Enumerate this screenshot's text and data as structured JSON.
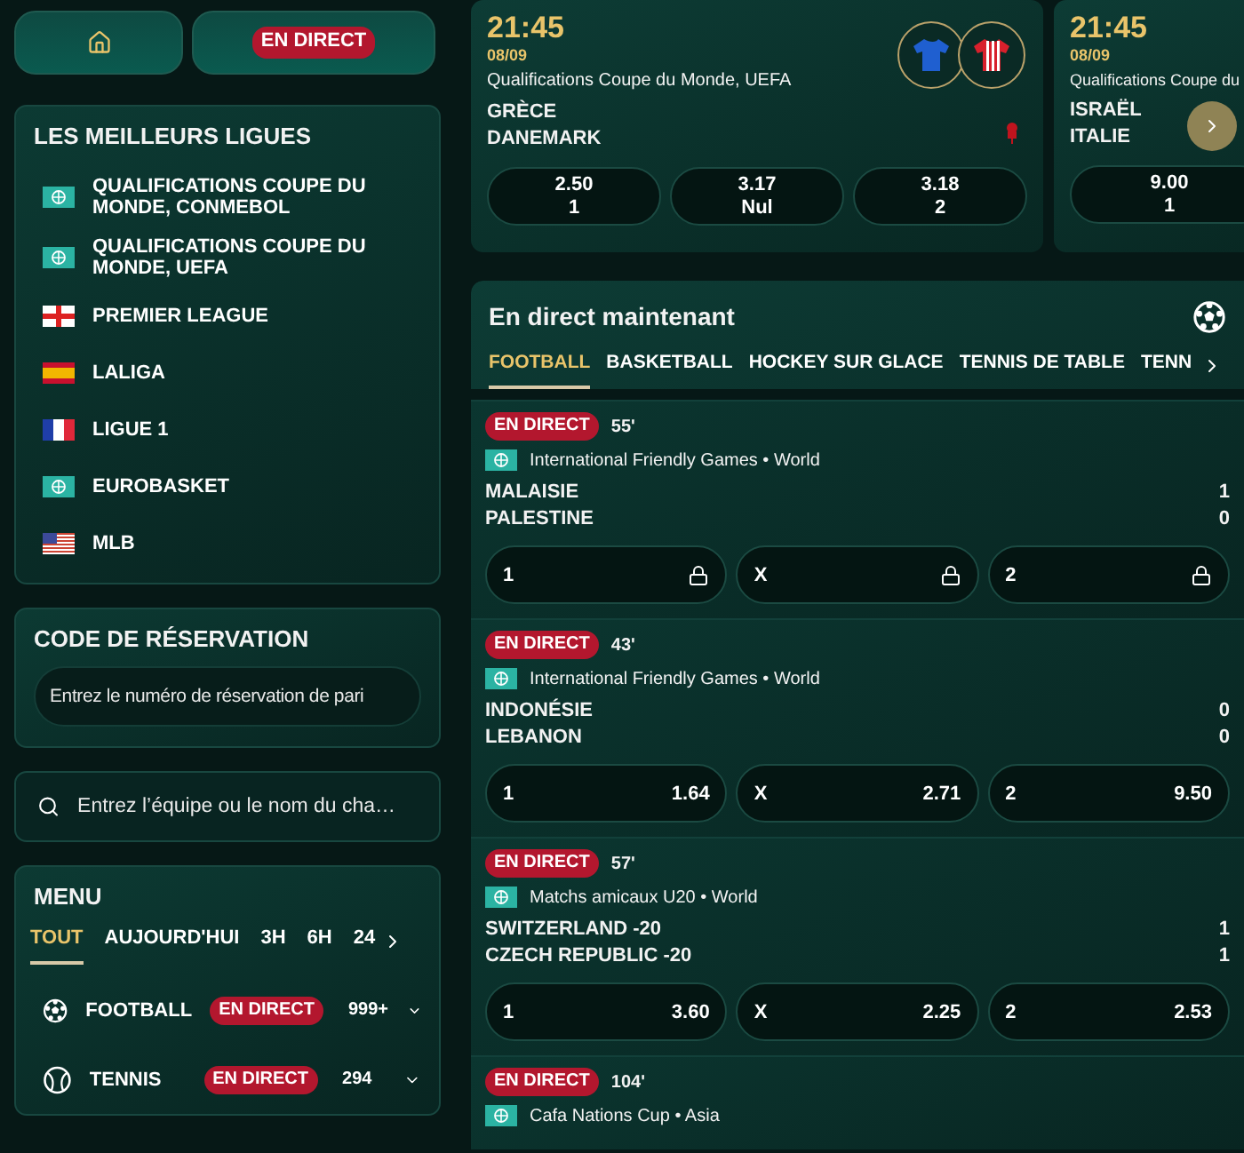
{
  "nav": {
    "live_label": "EN DIRECT"
  },
  "top_leagues": {
    "title": "LES MEILLEURS LIGUES",
    "items": [
      {
        "name": "QUALIFICATIONS COUPE DU MONDE, CONMEBOL",
        "kind": "world"
      },
      {
        "name": "QUALIFICATIONS COUPE DU MONDE, UEFA",
        "kind": "world"
      },
      {
        "name": "PREMIER LEAGUE",
        "kind": "england"
      },
      {
        "name": "LALIGA",
        "kind": "spain"
      },
      {
        "name": "LIGUE 1",
        "kind": "france"
      },
      {
        "name": "EUROBASKET",
        "kind": "world"
      },
      {
        "name": "MLB",
        "kind": "usa"
      }
    ]
  },
  "reservation": {
    "title": "CODE DE RÉSERVATION",
    "placeholder": "Entrez le numéro de réservation de pari"
  },
  "search": {
    "placeholder": "Entrez l’équipe ou le nom du cha…"
  },
  "menu": {
    "title": "MENU",
    "filters": [
      {
        "label": "TOUT",
        "selected": true
      },
      {
        "label": "AUJOURD'HUI",
        "selected": false
      },
      {
        "label": "3H",
        "selected": false
      },
      {
        "label": "6H",
        "selected": false
      },
      {
        "label": "24",
        "selected": false
      }
    ],
    "sports": [
      {
        "name": "FOOTBALL",
        "kind": "football",
        "live_label": "EN DIRECT",
        "count": "999+"
      },
      {
        "name": "TENNIS",
        "kind": "tennis",
        "live_label": "EN DIRECT",
        "count": "294"
      }
    ]
  },
  "featured": [
    {
      "time": "21:45",
      "date": "08/09",
      "league": "Qualifications Coupe du Monde, UEFA",
      "home": "GRÈCE",
      "away": "DANEMARK",
      "marker": true,
      "kits": [
        {
          "color": "#1f5fd0",
          "kind": "plain"
        },
        {
          "color": "#d8202c",
          "kind": "striped"
        }
      ],
      "odds": [
        {
          "value": "2.50",
          "label": "1"
        },
        {
          "value": "3.17",
          "label": "Nul"
        },
        {
          "value": "3.18",
          "label": "2"
        }
      ]
    },
    {
      "time": "21:45",
      "date": "08/09",
      "league": "Qualifications Coupe du",
      "home": "ISRAËL",
      "away": "ITALIE",
      "odds": [
        {
          "value": "9.00",
          "label": "1"
        }
      ]
    }
  ],
  "live": {
    "title": "En direct maintenant",
    "tabs": [
      {
        "label": "FOOTBALL",
        "selected": true
      },
      {
        "label": "BASKETBALL",
        "selected": false
      },
      {
        "label": "HOCKEY SUR GLACE",
        "selected": false
      },
      {
        "label": "TENNIS DE TABLE",
        "selected": false
      },
      {
        "label": "TENN",
        "selected": false
      }
    ],
    "matches": [
      {
        "status": "EN DIRECT",
        "minute": "55'",
        "league": "International Friendly Games • World",
        "teams": [
          {
            "name": "MALAISIE",
            "score": "1"
          },
          {
            "name": "PALESTINE",
            "score": "0"
          }
        ],
        "odds": [
          {
            "label": "1",
            "locked": true
          },
          {
            "label": "X",
            "locked": true
          },
          {
            "label": "2",
            "locked": true
          }
        ]
      },
      {
        "status": "EN DIRECT",
        "minute": "43'",
        "league": "International Friendly Games • World",
        "teams": [
          {
            "name": "INDONÉSIE",
            "score": "0"
          },
          {
            "name": "LEBANON",
            "score": "0"
          }
        ],
        "odds": [
          {
            "label": "1",
            "value": "1.64",
            "locked": false
          },
          {
            "label": "X",
            "value": "2.71",
            "locked": false
          },
          {
            "label": "2",
            "value": "9.50",
            "locked": false
          }
        ]
      },
      {
        "status": "EN DIRECT",
        "minute": "57'",
        "league": "Matchs amicaux U20 • World",
        "teams": [
          {
            "name": "SWITZERLAND -20",
            "score": "1"
          },
          {
            "name": "CZECH REPUBLIC -20",
            "score": "1"
          }
        ],
        "odds": [
          {
            "label": "1",
            "value": "3.60",
            "locked": false
          },
          {
            "label": "X",
            "value": "2.25",
            "locked": false
          },
          {
            "label": "2",
            "value": "2.53",
            "locked": false
          }
        ]
      },
      {
        "status": "EN DIRECT",
        "minute": "104'",
        "league": "Cafa Nations Cup • Asia"
      }
    ]
  }
}
